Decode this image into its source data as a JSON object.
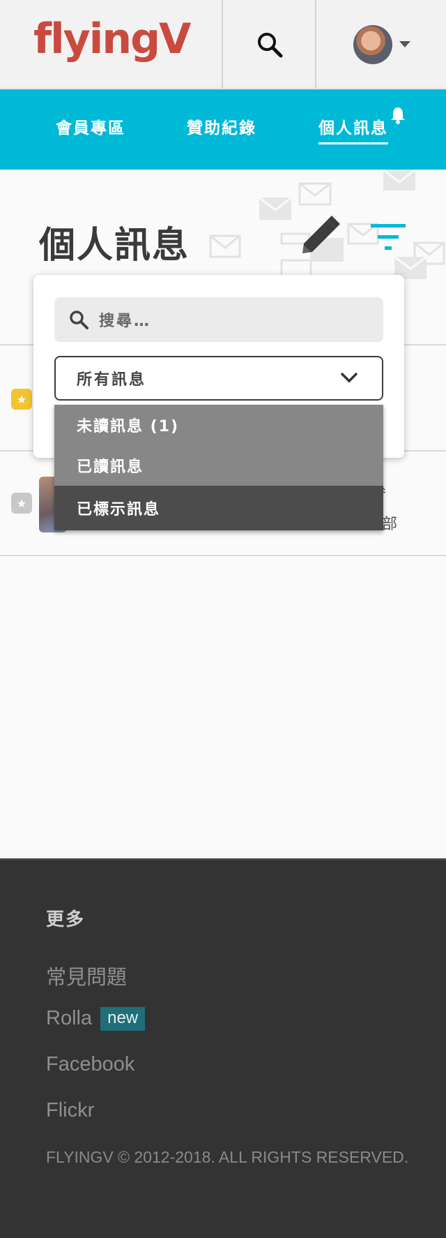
{
  "header": {
    "logo_text": "flyingV",
    "search_icon": "search-icon",
    "avatar_icon": "avatar",
    "caret_icon": "caret-down-icon"
  },
  "nav": {
    "items": [
      {
        "label": "會員專區"
      },
      {
        "label": "贊助紀錄"
      },
      {
        "label": "個人訊息"
      }
    ],
    "active_index": 2,
    "notification_icon": "bell-icon"
  },
  "main": {
    "title": "個人訊息",
    "compose_icon": "pencil-icon",
    "filter_icon": "filter-icon",
    "row_fragments": [
      "參",
      "部"
    ]
  },
  "filter_panel": {
    "search_placeholder": "搜尋…",
    "select_value": "所有訊息",
    "options": [
      {
        "label": "未讀訊息 (1)"
      },
      {
        "label": "已讀訊息"
      },
      {
        "label": "已標示訊息"
      }
    ],
    "highlighted_index": 2
  },
  "footer": {
    "title": "更多",
    "links": [
      {
        "label": "常見問題"
      },
      {
        "label": "Rolla",
        "badge": "new"
      },
      {
        "label": "Facebook"
      },
      {
        "label": "Flickr"
      }
    ],
    "copyright": "FLYINGV © 2012-2018. ALL RIGHTS RESERVED."
  },
  "colors": {
    "brand_red": "#c94a3e",
    "nav_cyan": "#00b9d6",
    "star_yellow": "#f4c430",
    "star_grey": "#c8c8c8",
    "footer_bg": "#333333",
    "badge_bg": "#1f6e78"
  }
}
